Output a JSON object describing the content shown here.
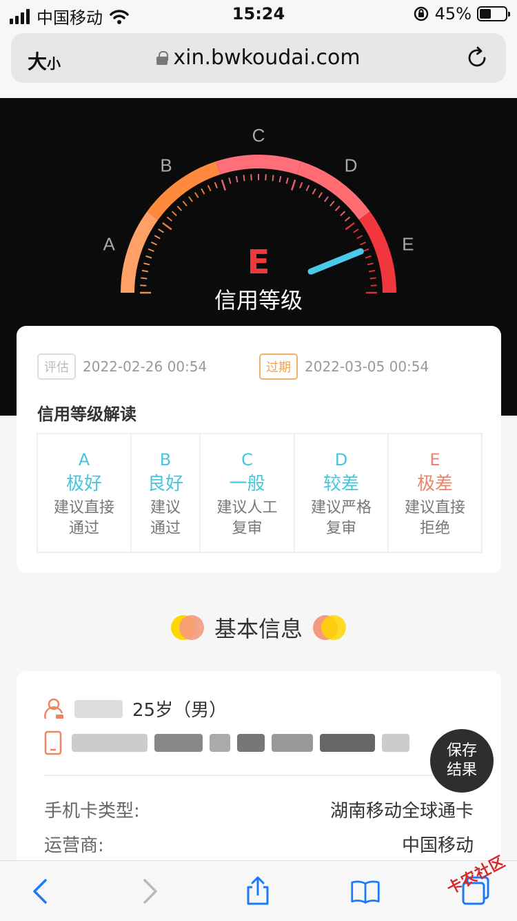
{
  "status_bar": {
    "carrier": "中国移动",
    "time": "15:24",
    "battery_percent": "45%",
    "battery_level": 0.45
  },
  "browser": {
    "text_size_big": "大",
    "text_size_small": "小",
    "url": "xin.bwkoudai.com"
  },
  "gauge": {
    "grades": [
      "A",
      "B",
      "C",
      "D",
      "E"
    ],
    "current_grade": "E",
    "label": "信用等级",
    "colors": {
      "segment_a": "#ffa066",
      "segment_b": "#ff8a3d",
      "segment_c": "#ff6f7a",
      "segment_d": "#ff6c72",
      "segment_e": "#f2363d",
      "needle": "#4cc8e8",
      "grade_text": "#ee3a3f"
    }
  },
  "report": {
    "assess_tag": "评估",
    "assess_date": "2022-02-26 00:54",
    "expire_tag": "过期",
    "expire_date": "2022-03-05 00:54",
    "section_title": "信用等级解读",
    "grades": [
      {
        "letter": "A",
        "name": "极好",
        "desc1": "建议直接",
        "desc2": "通过",
        "color": "#45c6dc"
      },
      {
        "letter": "B",
        "name": "良好",
        "desc1": "建议",
        "desc2": "通过",
        "color": "#45c6dc"
      },
      {
        "letter": "C",
        "name": "一般",
        "desc1": "建议人工",
        "desc2": "复审",
        "color": "#45c6dc"
      },
      {
        "letter": "D",
        "name": "较差",
        "desc1": "建议严格",
        "desc2": "复审",
        "color": "#45c6dc"
      },
      {
        "letter": "E",
        "name": "极差",
        "desc1": "建议直接",
        "desc2": "拒绝",
        "color": "#f08468"
      }
    ]
  },
  "basic_info": {
    "heading": "基本信息",
    "person": "25岁（男）",
    "fields": [
      {
        "label": "手机卡类型:",
        "value": "湖南移动全球通卡"
      },
      {
        "label": "运营商:",
        "value": "中国移动"
      }
    ]
  },
  "save_button": {
    "line1": "保存",
    "line2": "结果"
  },
  "watermark": "卡农社区"
}
